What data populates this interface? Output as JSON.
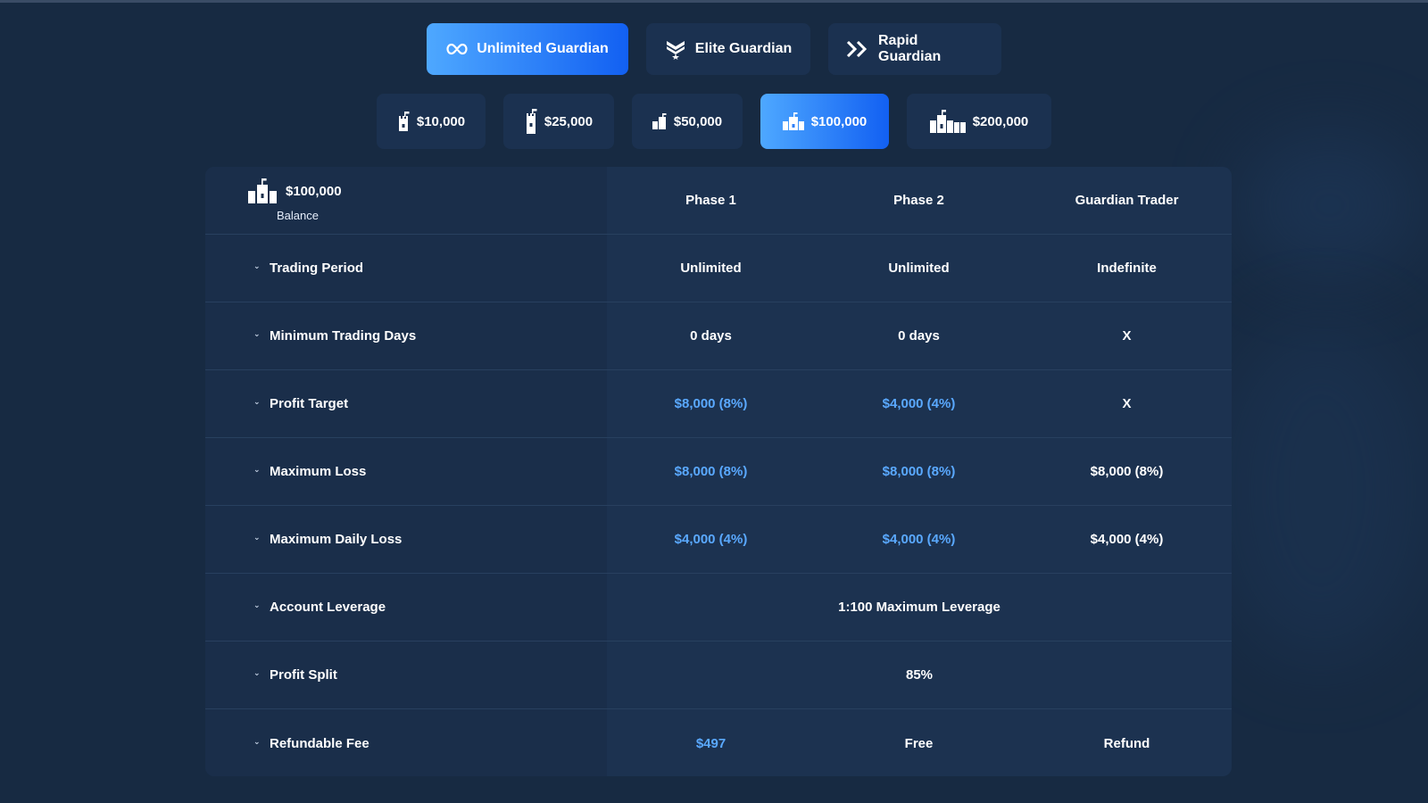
{
  "plan_tabs": [
    {
      "label": "Unlimited Guardian",
      "icon": "infinity-icon",
      "active": true
    },
    {
      "label": "Elite Guardian",
      "icon": "chevron-badge-icon",
      "active": false
    },
    {
      "label": "Rapid Guardian",
      "icon": "double-chevron-icon",
      "active": false
    }
  ],
  "size_tabs": [
    {
      "label": "$10,000",
      "icon": "tower-icon",
      "active": false
    },
    {
      "label": "$25,000",
      "icon": "tower-icon",
      "active": false
    },
    {
      "label": "$50,000",
      "icon": "tower-icon",
      "active": false
    },
    {
      "label": "$100,000",
      "icon": "castle-icon",
      "active": true
    },
    {
      "label": "$200,000",
      "icon": "castle-icon",
      "active": false
    }
  ],
  "table": {
    "header": {
      "balance_value": "$100,000",
      "balance_label": "Balance",
      "columns": [
        "Phase 1",
        "Phase 2",
        "Guardian Trader"
      ]
    },
    "rows": [
      {
        "label": "Trading Period",
        "values": [
          "Unlimited",
          "Unlimited",
          "Indefinite"
        ]
      },
      {
        "label": "Minimum Trading Days",
        "values": [
          "0 days",
          "0 days",
          "X"
        ]
      },
      {
        "label": "Profit Target",
        "values": [
          "$8,000 (8%)",
          "$4,000 (4%)",
          "X"
        ]
      },
      {
        "label": "Maximum Loss",
        "values": [
          "$8,000 (8%)",
          "$8,000 (8%)",
          "$8,000 (8%)"
        ]
      },
      {
        "label": "Maximum Daily Loss",
        "values": [
          "$4,000 (4%)",
          "$4,000 (4%)",
          "$4,000 (4%)"
        ]
      },
      {
        "label": "Account Leverage",
        "span_value": "1:100 Maximum Leverage"
      },
      {
        "label": "Profit Split",
        "span_value": "85%"
      },
      {
        "label": "Refundable Fee",
        "values": [
          "$497",
          "Free",
          "Refund"
        ]
      }
    ]
  },
  "colors": {
    "accent": "#1260f2",
    "highlight_text": "#5aa9ff",
    "background": "#172a42"
  }
}
